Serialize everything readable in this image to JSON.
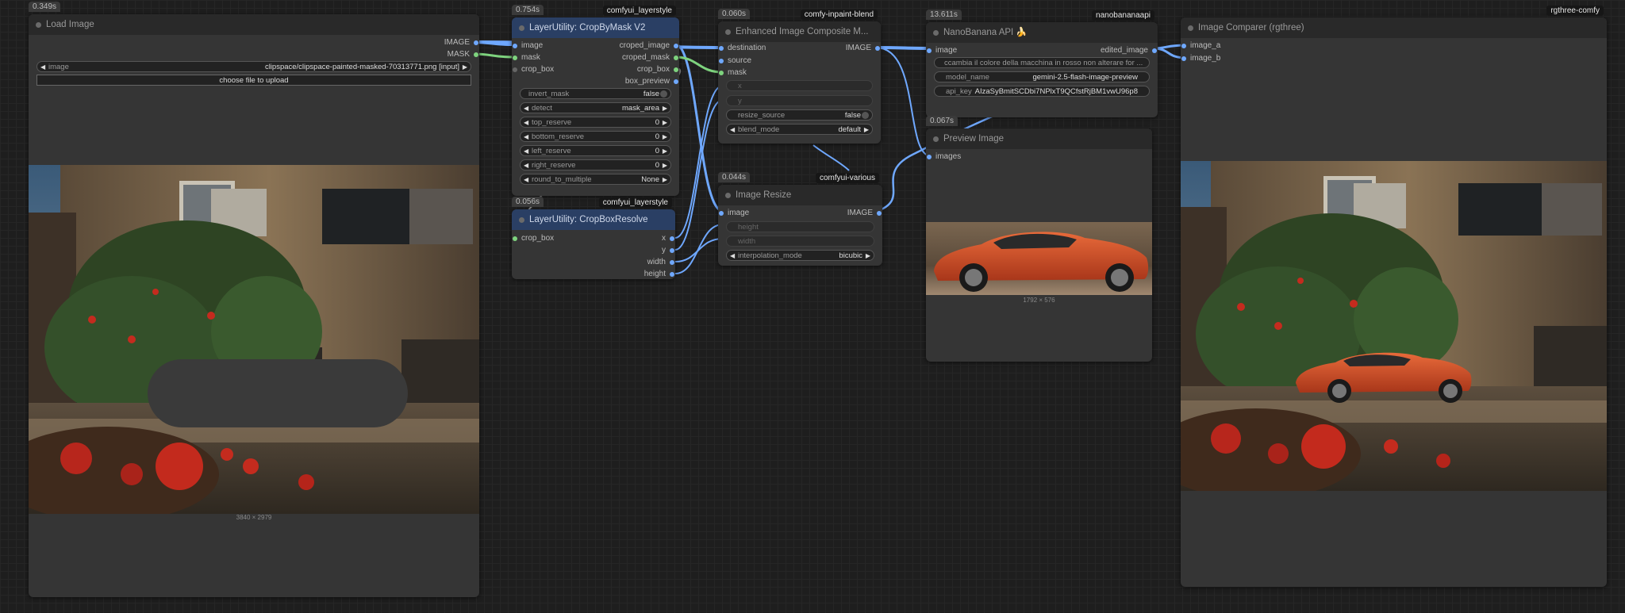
{
  "load_image": {
    "time": "0.349s",
    "title": "Load Image",
    "out_image": "IMAGE",
    "out_mask": "MASK",
    "widget_label": "image",
    "widget_value": "clipspace/clipspace-painted-masked-70313771.png [input]",
    "upload_label": "choose file to upload",
    "image_size": "3840 × 2979"
  },
  "crop_by_mask": {
    "time": "0.754s",
    "package": "comfyui_layerstyle",
    "title": "LayerUtility: CropByMask V2",
    "inputs": [
      "image",
      "mask",
      "crop_box"
    ],
    "outputs": [
      "croped_image",
      "croped_mask",
      "crop_box",
      "box_preview"
    ],
    "widgets": [
      {
        "label": "invert_mask",
        "value": "false"
      },
      {
        "label": "detect",
        "value": "mask_area"
      },
      {
        "label": "top_reserve",
        "value": "0"
      },
      {
        "label": "bottom_reserve",
        "value": "0"
      },
      {
        "label": "left_reserve",
        "value": "0"
      },
      {
        "label": "right_reserve",
        "value": "0"
      },
      {
        "label": "round_to_multiple",
        "value": "None"
      }
    ]
  },
  "crop_box_resolve": {
    "time": "0.056s",
    "package": "comfyui_layerstyle",
    "title": "LayerUtility: CropBoxResolve",
    "input": "crop_box",
    "outputs": [
      "x",
      "y",
      "width",
      "height"
    ]
  },
  "composite": {
    "time": "0.060s",
    "package": "comfy-inpaint-blend",
    "title": "Enhanced Image Composite M...",
    "inputs": [
      "destination",
      "source",
      "mask"
    ],
    "output": "IMAGE",
    "converted": [
      "x",
      "y"
    ],
    "widgets": [
      {
        "label": "resize_source",
        "value": "false"
      },
      {
        "label": "blend_mode",
        "value": "default"
      }
    ]
  },
  "image_resize": {
    "time": "0.044s",
    "package": "comfyui-various",
    "title": "Image Resize",
    "input": "image",
    "output": "IMAGE",
    "converted": [
      "height",
      "width"
    ],
    "widget": {
      "label": "interpolation_mode",
      "value": "bicubic"
    }
  },
  "nanobanana": {
    "time": "13.611s",
    "package": "nanobananaapi",
    "title": "NanoBanana API 🍌",
    "input": "image",
    "output": "edited_image",
    "prompt": "ccambia il colore della macchina in rosso non alterare for ...",
    "model_label": "model_name",
    "model_value": "gemini-2.5-flash-image-preview",
    "key_label": "api_key",
    "key_value": "AIzaSyBmitSCDbi7NPlxT9QCfstRjBM1vwU96p8"
  },
  "preview": {
    "time": "0.067s",
    "title": "Preview Image",
    "input": "images",
    "image_size": "1792 × 576"
  },
  "comparer": {
    "package": "rgthree-comfy",
    "title": "Image Comparer (rgthree)",
    "inputs": [
      "image_a",
      "image_b"
    ]
  },
  "colors": {
    "wire_image": "#6fa8ff",
    "wire_mask": "#7ed37e",
    "canvas": "#1e1e1e",
    "node": "#353535",
    "node_title_blue": "#2a3f64"
  }
}
